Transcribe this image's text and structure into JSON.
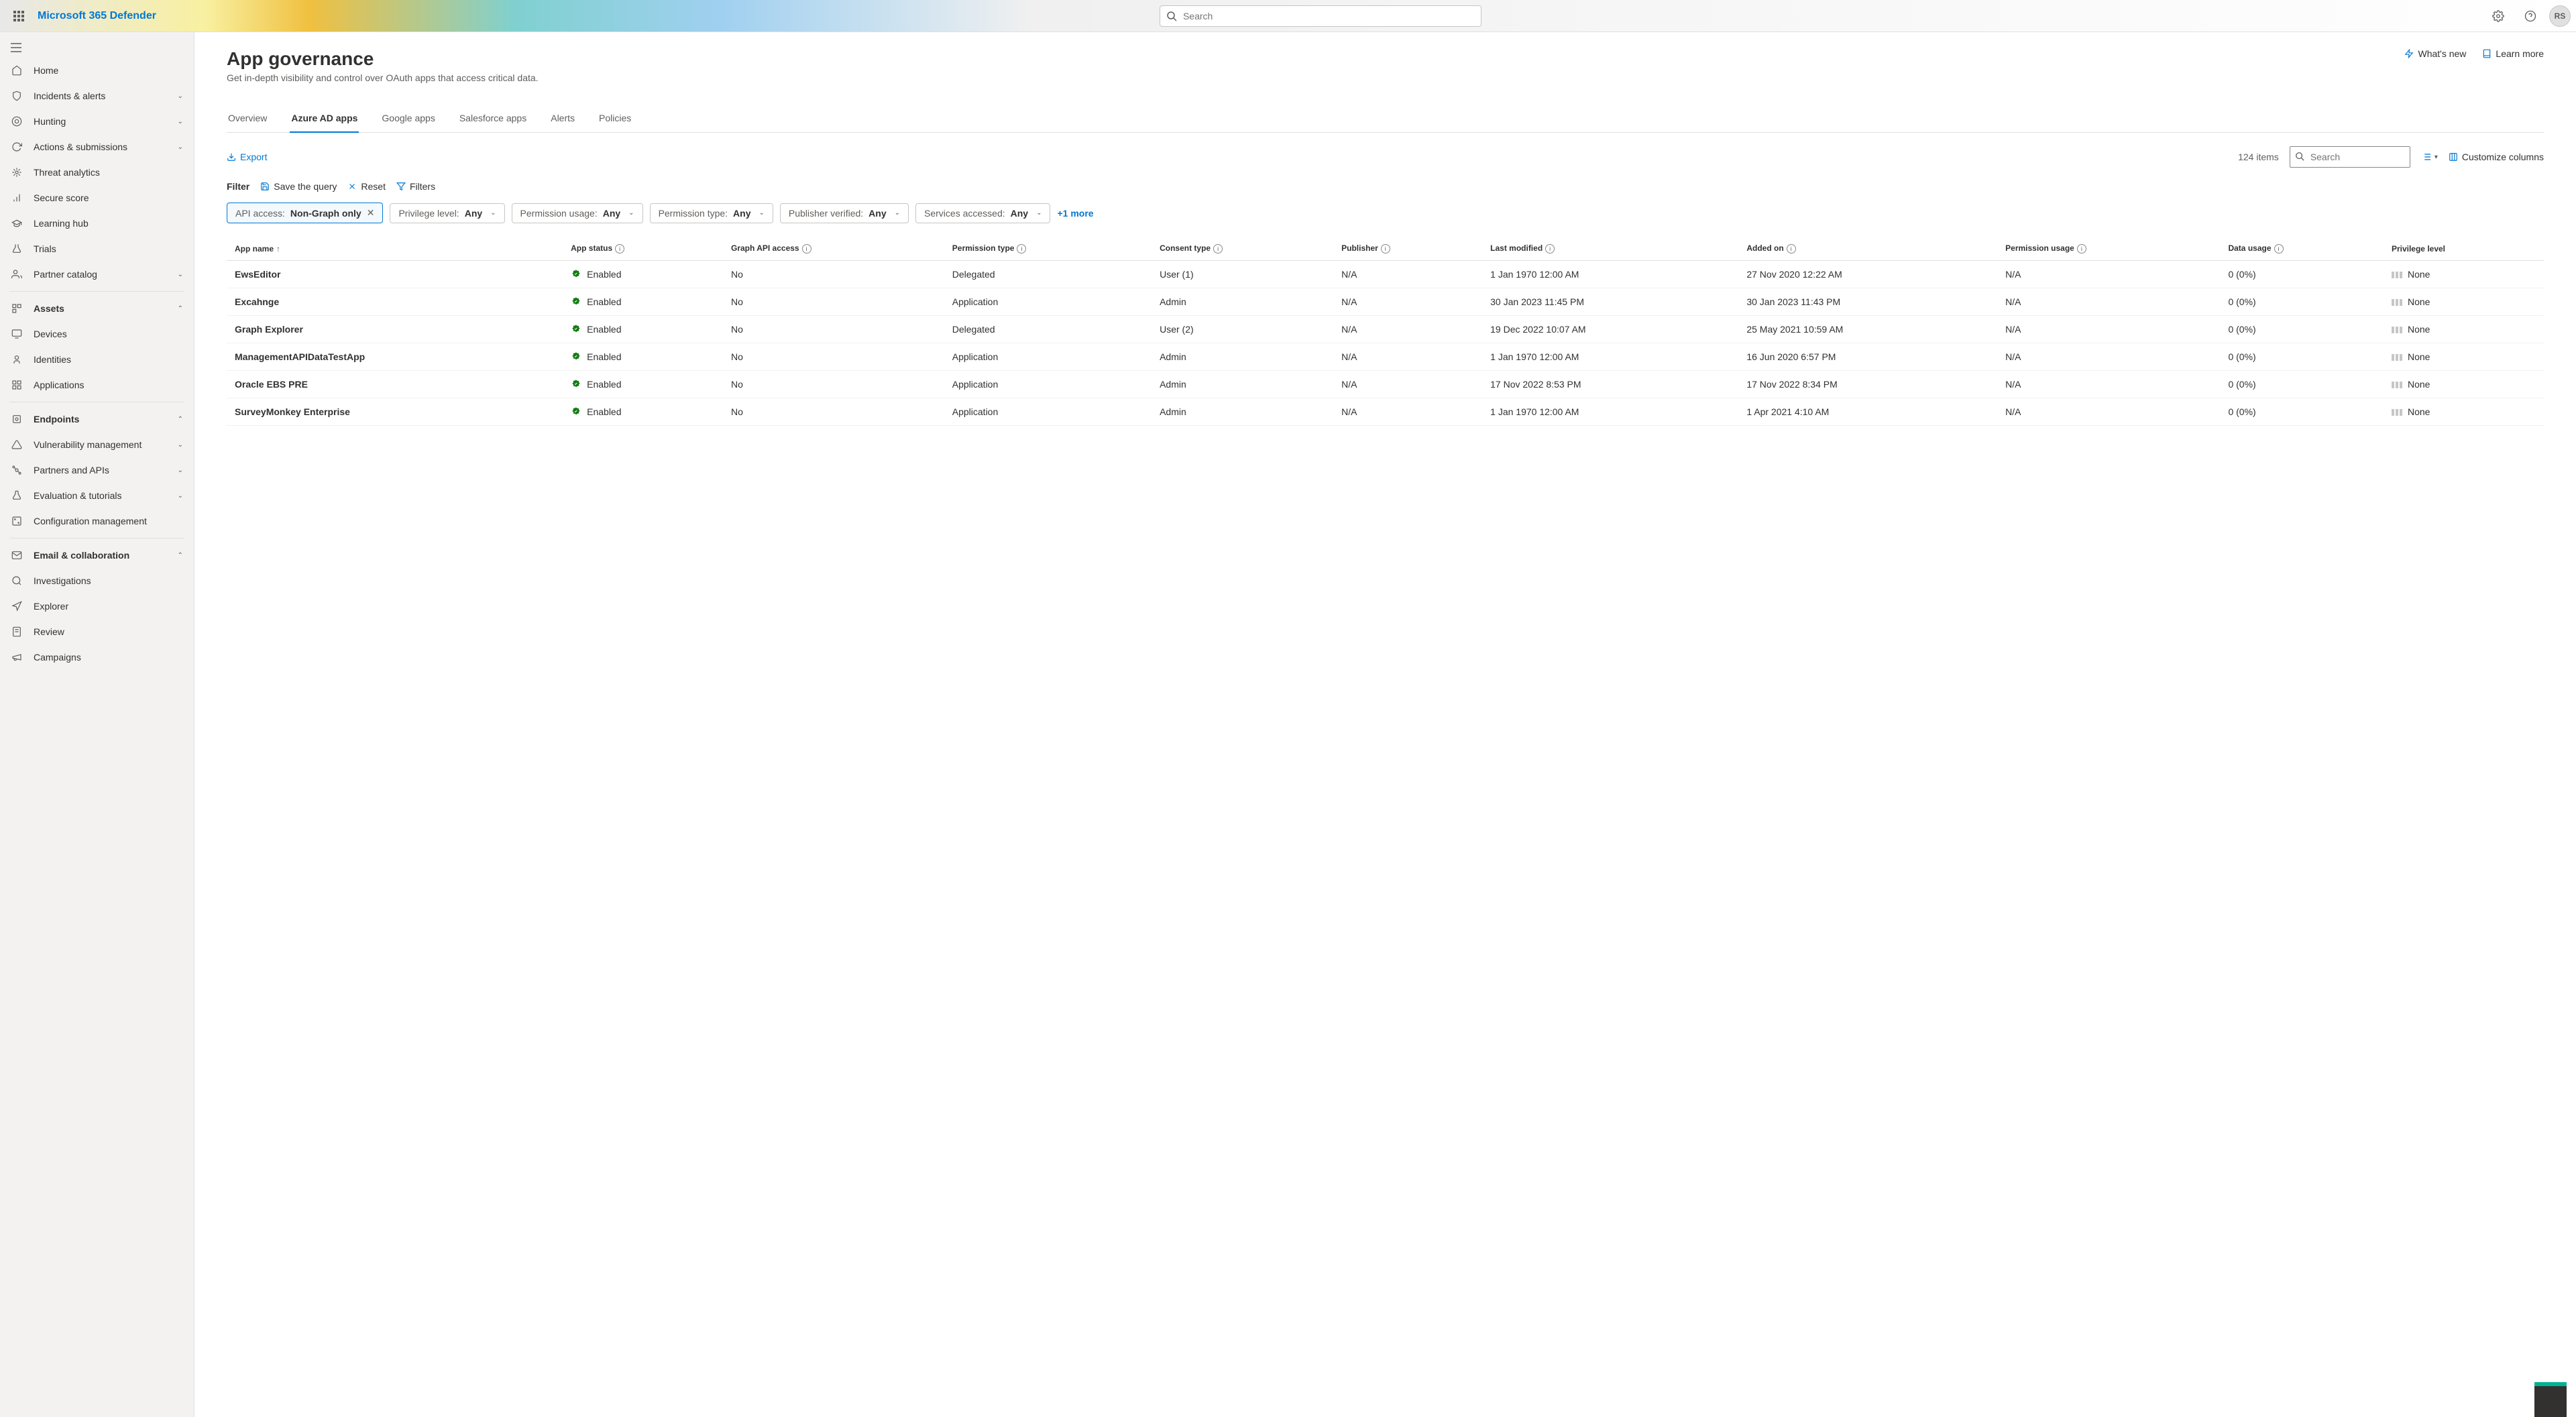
{
  "brand": "Microsoft 365 Defender",
  "topSearchPlaceholder": "Search",
  "avatarInitials": "RS",
  "sidebar": {
    "items": [
      {
        "label": "Home",
        "icon": "home"
      },
      {
        "label": "Incidents & alerts",
        "icon": "shield",
        "expandable": true
      },
      {
        "label": "Hunting",
        "icon": "target",
        "expandable": true
      },
      {
        "label": "Actions & submissions",
        "icon": "sync",
        "expandable": true
      },
      {
        "label": "Threat analytics",
        "icon": "threat"
      },
      {
        "label": "Secure score",
        "icon": "score"
      },
      {
        "label": "Learning hub",
        "icon": "learn"
      },
      {
        "label": "Trials",
        "icon": "trials"
      },
      {
        "label": "Partner catalog",
        "icon": "partner",
        "expandable": true
      },
      {
        "divider": true
      },
      {
        "label": "Assets",
        "icon": "assets",
        "expandable": true,
        "bold": true,
        "expanded": true
      },
      {
        "label": "Devices",
        "icon": "device",
        "sub": false
      },
      {
        "label": "Identities",
        "icon": "identity",
        "sub": false
      },
      {
        "label": "Applications",
        "icon": "apps",
        "sub": false
      },
      {
        "divider": true
      },
      {
        "label": "Endpoints",
        "icon": "endpoints",
        "expandable": true,
        "bold": true,
        "expanded": true
      },
      {
        "label": "Vulnerability management",
        "icon": "vuln",
        "expandable": true
      },
      {
        "label": "Partners and APIs",
        "icon": "api",
        "expandable": true
      },
      {
        "label": "Evaluation & tutorials",
        "icon": "eval",
        "expandable": true
      },
      {
        "label": "Configuration management",
        "icon": "config"
      },
      {
        "divider": true
      },
      {
        "label": "Email & collaboration",
        "icon": "mail",
        "expandable": true,
        "bold": true,
        "expanded": true
      },
      {
        "label": "Investigations",
        "icon": "investigate"
      },
      {
        "label": "Explorer",
        "icon": "explorer"
      },
      {
        "label": "Review",
        "icon": "review"
      },
      {
        "label": "Campaigns",
        "icon": "campaign"
      }
    ]
  },
  "page": {
    "title": "App governance",
    "subtitle": "Get in-depth visibility and control over OAuth apps that access critical data.",
    "whatsNew": "What's new",
    "learnMore": "Learn more"
  },
  "tabs": [
    "Overview",
    "Azure AD apps",
    "Google apps",
    "Salesforce apps",
    "Alerts",
    "Policies"
  ],
  "activeTab": 1,
  "toolbar": {
    "export": "Export",
    "itemCount": "124 items",
    "searchPlaceholder": "Search",
    "customize": "Customize columns"
  },
  "filterbar": {
    "filterLabel": "Filter",
    "saveQuery": "Save the query",
    "reset": "Reset",
    "filters": "Filters"
  },
  "pills": [
    {
      "label": "API access:",
      "value": "Non-Graph only",
      "active": true,
      "closable": true
    },
    {
      "label": "Privilege level:",
      "value": "Any"
    },
    {
      "label": "Permission usage:",
      "value": "Any"
    },
    {
      "label": "Permission type:",
      "value": "Any"
    },
    {
      "label": "Publisher verified:",
      "value": "Any"
    },
    {
      "label": "Services accessed:",
      "value": "Any"
    }
  ],
  "moreFilters": "+1 more",
  "columns": [
    {
      "label": "App name",
      "sort": true
    },
    {
      "label": "App status",
      "info": true
    },
    {
      "label": "Graph API access",
      "info": true
    },
    {
      "label": "Permission type",
      "info": true
    },
    {
      "label": "Consent type",
      "info": true
    },
    {
      "label": "Publisher",
      "info": true
    },
    {
      "label": "Last modified",
      "info": true
    },
    {
      "label": "Added on",
      "info": true
    },
    {
      "label": "Permission usage",
      "info": true
    },
    {
      "label": "Data usage",
      "info": true
    },
    {
      "label": "Privilege level"
    }
  ],
  "rows": [
    {
      "name": "EwsEditor",
      "status": "Enabled",
      "graph": "No",
      "ptype": "Delegated",
      "consent": "User (1)",
      "publisher": "N/A",
      "modified": "1 Jan 1970 12:00 AM",
      "added": "27 Nov 2020 12:22 AM",
      "pusage": "N/A",
      "dusage": "0 (0%)",
      "priv": "None"
    },
    {
      "name": "Excahnge",
      "status": "Enabled",
      "graph": "No",
      "ptype": "Application",
      "consent": "Admin",
      "publisher": "N/A",
      "modified": "30 Jan 2023 11:45 PM",
      "added": "30 Jan 2023 11:43 PM",
      "pusage": "N/A",
      "dusage": "0 (0%)",
      "priv": "None"
    },
    {
      "name": "Graph Explorer",
      "status": "Enabled",
      "graph": "No",
      "ptype": "Delegated",
      "consent": "User (2)",
      "publisher": "N/A",
      "modified": "19 Dec 2022 10:07 AM",
      "added": "25 May 2021 10:59 AM",
      "pusage": "N/A",
      "dusage": "0 (0%)",
      "priv": "None"
    },
    {
      "name": "ManagementAPIDataTestApp",
      "status": "Enabled",
      "graph": "No",
      "ptype": "Application",
      "consent": "Admin",
      "publisher": "N/A",
      "modified": "1 Jan 1970 12:00 AM",
      "added": "16 Jun 2020 6:57 PM",
      "pusage": "N/A",
      "dusage": "0 (0%)",
      "priv": "None"
    },
    {
      "name": "Oracle EBS PRE",
      "status": "Enabled",
      "graph": "No",
      "ptype": "Application",
      "consent": "Admin",
      "publisher": "N/A",
      "modified": "17 Nov 2022 8:53 PM",
      "added": "17 Nov 2022 8:34 PM",
      "pusage": "N/A",
      "dusage": "0 (0%)",
      "priv": "None"
    },
    {
      "name": "SurveyMonkey Enterprise",
      "status": "Enabled",
      "graph": "No",
      "ptype": "Application",
      "consent": "Admin",
      "publisher": "N/A",
      "modified": "1 Jan 1970 12:00 AM",
      "added": "1 Apr 2021 4:10 AM",
      "pusage": "N/A",
      "dusage": "0 (0%)",
      "priv": "None"
    }
  ]
}
